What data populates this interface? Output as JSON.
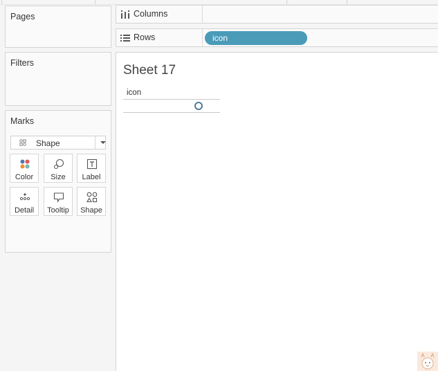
{
  "left_panel": {
    "pages": {
      "title": "Pages"
    },
    "filters": {
      "title": "Filters"
    },
    "marks": {
      "title": "Marks",
      "mark_type": {
        "selected": "Shape",
        "icon": "shape-icon"
      },
      "buttons": [
        {
          "label": "Color",
          "icon": "color-icon"
        },
        {
          "label": "Size",
          "icon": "size-icon"
        },
        {
          "label": "Label",
          "icon": "label-icon"
        },
        {
          "label": "Detail",
          "icon": "detail-icon"
        },
        {
          "label": "Tooltip",
          "icon": "tooltip-icon"
        },
        {
          "label": "Shape",
          "icon": "shape-icon"
        }
      ]
    }
  },
  "shelves": {
    "columns": {
      "label": "Columns",
      "icon": "columns-icon",
      "pills": []
    },
    "rows": {
      "label": "Rows",
      "icon": "rows-icon",
      "pills": [
        {
          "label": "icon",
          "color": "#4a9bb8"
        }
      ]
    }
  },
  "view": {
    "sheet_title": "Sheet 17",
    "header_label": "icon",
    "mark_color": "#4e7a97"
  },
  "colors": {
    "accent": "#4a9bb8",
    "background": "#f5f5f5",
    "card_background": "#fafafa",
    "border": "#d4d4d4"
  }
}
